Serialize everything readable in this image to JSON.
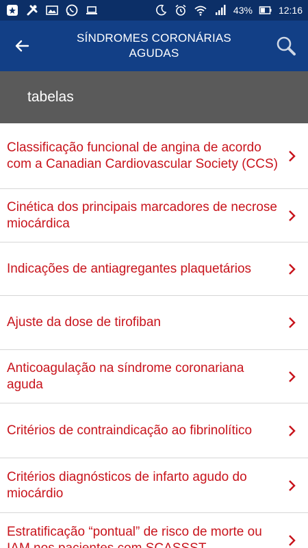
{
  "status_bar": {
    "battery_percent": "43%",
    "time": "12:16"
  },
  "app_bar": {
    "title_line1": "SÍNDROMES CORONÁRIAS",
    "title_line2": "AGUDAS"
  },
  "section": {
    "title": "tabelas"
  },
  "list": {
    "items": [
      {
        "label": "Classificação funcional de angina de acordo com a Canadian Cardiovascular Society (CCS)"
      },
      {
        "label": "Cinética dos principais marcadores de necrose miocárdica"
      },
      {
        "label": "Indicações de antiagregantes plaquetários"
      },
      {
        "label": "Ajuste da dose de tirofiban"
      },
      {
        "label": "Anticoagulação na síndrome coronariana aguda"
      },
      {
        "label": "Critérios de contraindicação ao fibrinolítico"
      },
      {
        "label": "Critérios diagnósticos de infarto agudo do miocárdio"
      },
      {
        "label": "Estratificação “pontual” de risco de morte ou IAM nos pacientes com SCASSST"
      }
    ]
  },
  "colors": {
    "status_bar": "#0c2f67",
    "app_bar": "#123f86",
    "section_header": "#5a5a5a",
    "item_text": "#c8141c"
  }
}
